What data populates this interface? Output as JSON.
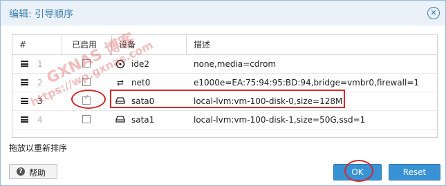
{
  "dialog": {
    "title": "编辑: 引导顺序",
    "close_icon": "close-circle-icon"
  },
  "grid": {
    "headers": {
      "num": "#",
      "enabled": "已启用",
      "device": "设备",
      "desc": "描述"
    },
    "rows": [
      {
        "num": "1",
        "enabled": false,
        "icon": "disc-icon",
        "device": "ide2",
        "desc": "none,media=cdrom"
      },
      {
        "num": "2",
        "enabled": false,
        "icon": "network-icon",
        "device": "net0",
        "desc": "e1000e=EA:75:94:95:BD:94,bridge=vmbr0,firewall=1"
      },
      {
        "num": "3",
        "enabled": true,
        "icon": "hdd-icon",
        "device": "sata0",
        "desc": "local-lvm:vm-100-disk-0,size=128M"
      },
      {
        "num": "4",
        "enabled": false,
        "icon": "hdd-icon",
        "device": "sata1",
        "desc": "local-lvm:vm-100-disk-1,size=50G,ssd=1"
      }
    ]
  },
  "hint": "拖放以重新排序",
  "buttons": {
    "help": "帮助",
    "ok": "OK",
    "reset": "Reset"
  },
  "watermark": {
    "line1": "GXNAS 博客",
    "line2": "https://wp.gxnas.com"
  },
  "colors": {
    "accent": "#3892d4",
    "title": "#3c7fb1",
    "annotation": "#d42a2a"
  }
}
